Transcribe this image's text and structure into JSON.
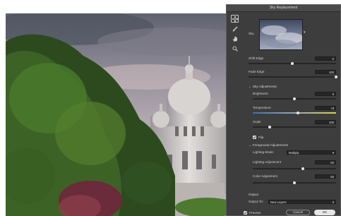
{
  "dialog": {
    "title": "Sky Replacement",
    "sky_label": "Sky",
    "shift_edge": {
      "label": "Shift Edge",
      "value": "0",
      "level": 0.5
    },
    "fade_edge": {
      "label": "Fade Edge",
      "value": "100",
      "level": 1.0
    },
    "sky_adjustments": {
      "header": "Sky Adjustments",
      "brightness": {
        "label": "Brightness",
        "value": "0",
        "level": 0.5
      },
      "temperature": {
        "label": "Temperature",
        "value": "+8",
        "level": 0.54
      },
      "scale": {
        "label": "Scale",
        "value": "100",
        "level": 0.2
      },
      "flip_label": "Flip",
      "flip_checked": true
    },
    "foreground_adjustments": {
      "header": "Foreground Adjustments",
      "lighting_mode": {
        "label": "Lighting Mode:",
        "value": "Multiply"
      },
      "lighting_adjustment": {
        "label": "Lighting Adjustment",
        "value": "50",
        "level": 0.6
      },
      "color_adjustment": {
        "label": "Color Adjustment",
        "value": "50",
        "level": 0.5
      }
    },
    "output": {
      "header": "Output",
      "output_to": {
        "label": "Output To:",
        "value": "New Layers"
      }
    },
    "preview": {
      "label": "Preview",
      "checked": true
    },
    "cancel_label": "Cancel",
    "ok_label": "OK"
  },
  "tools": [
    "move-icon",
    "sky-brush-icon",
    "hand-icon",
    "zoom-icon"
  ],
  "colors": {
    "dialog_bg": "#3d3d3d",
    "field_bg": "#262626",
    "ok_button": "#e6e6e6"
  }
}
